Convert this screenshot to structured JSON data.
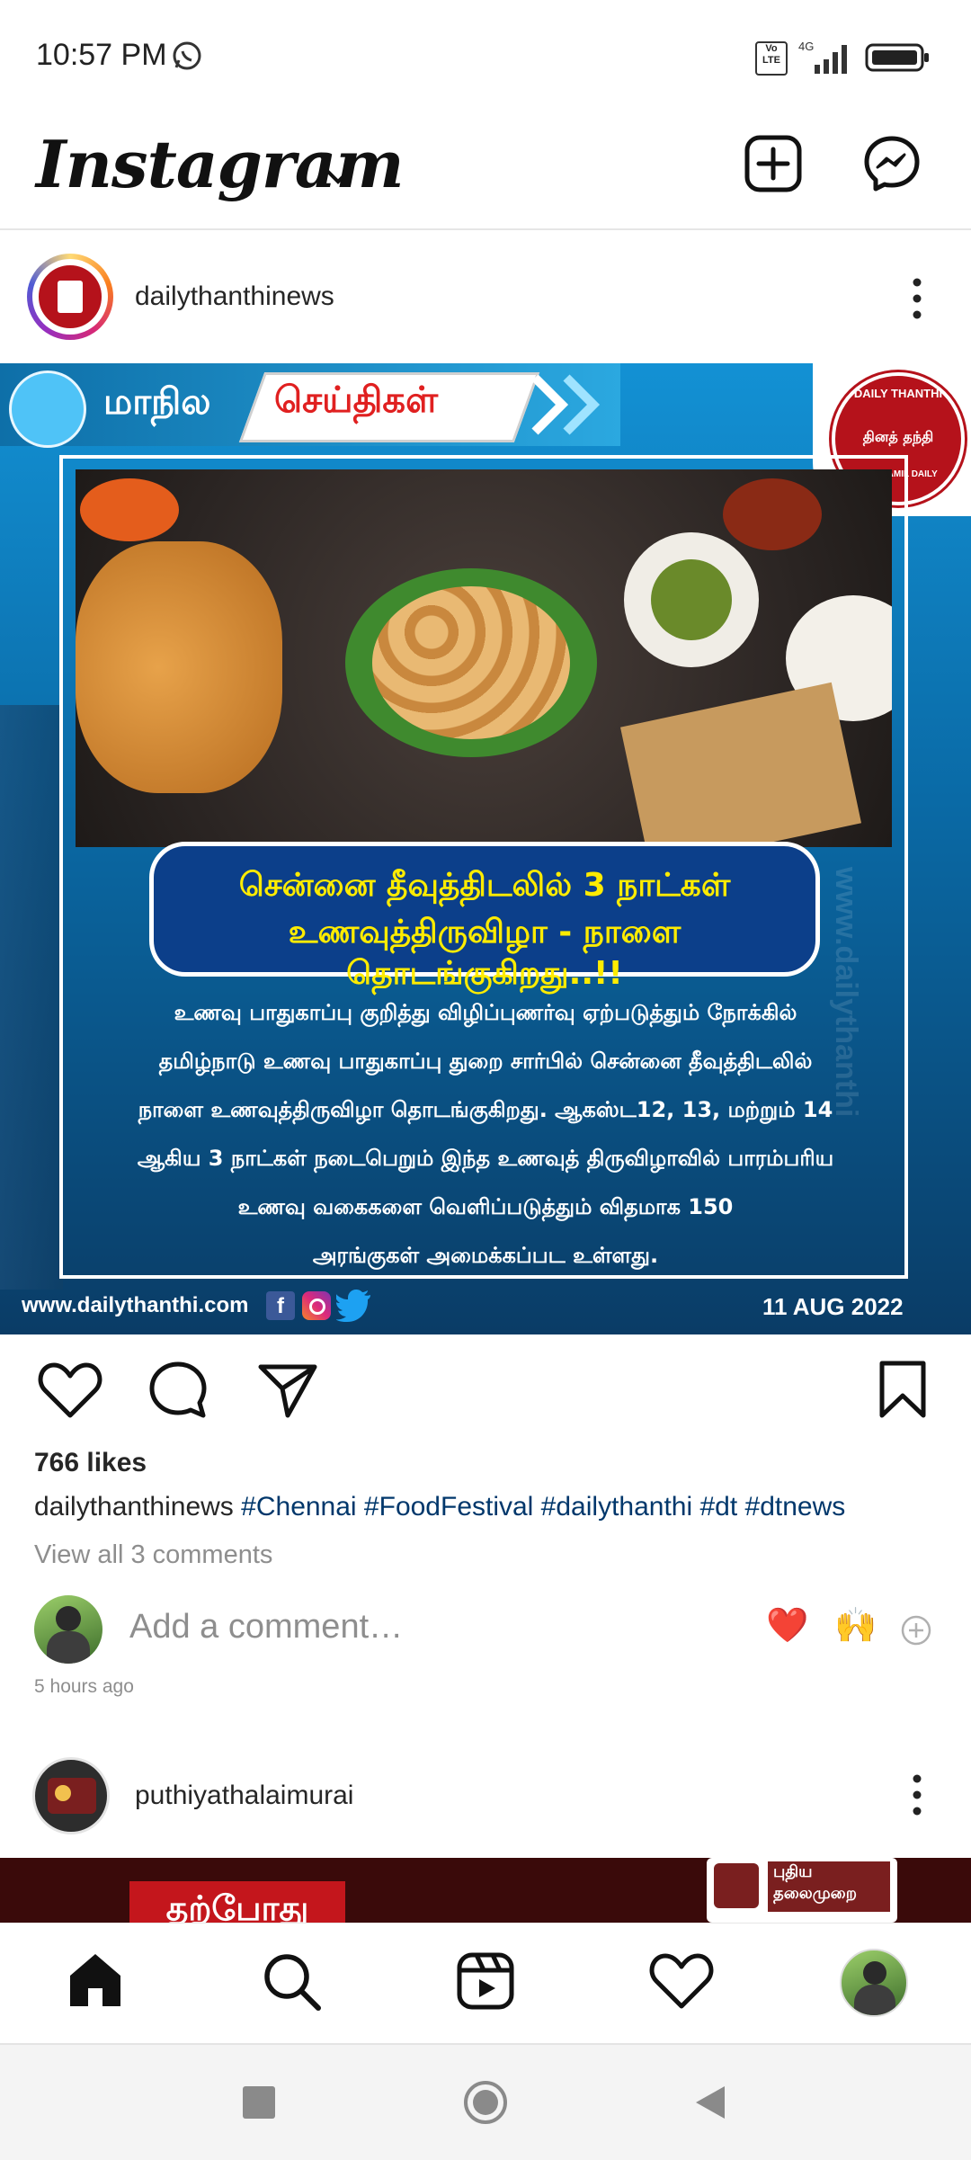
{
  "status_bar": {
    "time": "10:57 PM",
    "network": "4G",
    "volte": "Vo LTE",
    "icons": [
      "whatsapp-icon",
      "volte-icon",
      "signal-icon",
      "battery-icon"
    ]
  },
  "header": {
    "logo": "Instagram",
    "icons": [
      "chevron-down-icon",
      "new-post-icon",
      "messenger-icon"
    ]
  },
  "post": {
    "username": "dailythanthinews",
    "image": {
      "banner_left": "மாநில",
      "banner_right": "செய்திகள்",
      "brand_line1": "DAILY THANTHI",
      "brand_tamil": "தினத் தந்தி",
      "brand_line2": "NO.1 TAMIL DAILY",
      "headline_line1": "சென்னை தீவுத்திடலில் 3 நாட்கள்",
      "headline_line2": "உணவுத்திருவிழா - நாளை தொடங்குகிறது..!!",
      "body_lines": [
        "உணவு பாதுகாப்பு குறித்து விழிப்புணர்வு ஏற்படுத்தும் நோக்கில்",
        "தமிழ்நாடு உணவு பாதுகாப்பு துறை சார்பில் சென்னை தீவுத்திடலில்",
        "நாளை உணவுத்திருவிழா தொடங்குகிறது. ஆகஸ்ட12, 13, மற்றும் 14",
        "ஆகிய 3 நாட்கள் நடைபெறும் இந்த உணவுத் திருவிழாவில் பாரம்பரிய",
        "உணவு வகைகளை வெளிப்படுத்தும் விதமாக 150",
        "அரங்குகள் அமைக்கப்பட உள்ளது."
      ],
      "website": "www.dailythanthi.com",
      "side_watermark": "www.dailythanthi",
      "date": "11 AUG 2022"
    },
    "likes": "766 likes",
    "caption_user": "dailythanthinews",
    "hashtags": "#Chennai #FoodFestival #dailythanthi #dt #dtnews",
    "view_comments": "View all 3 comments",
    "comment_placeholder": "Add a comment…",
    "quick_reactions": [
      "❤️",
      "🙌"
    ],
    "timestamp": "5 hours ago"
  },
  "next_post": {
    "username": "puthiyathalaimurai",
    "banner_text": "தற்போது",
    "logo_text1": "புதிய",
    "logo_text2": "தலைமுறை"
  },
  "bottom_nav": {
    "items": [
      "home-icon",
      "search-icon",
      "reels-icon",
      "activity-icon",
      "profile-avatar"
    ]
  },
  "colors": {
    "hashtag": "#00376b",
    "accent_red": "#e0245e",
    "banner_blue": "#0b6ea8"
  }
}
